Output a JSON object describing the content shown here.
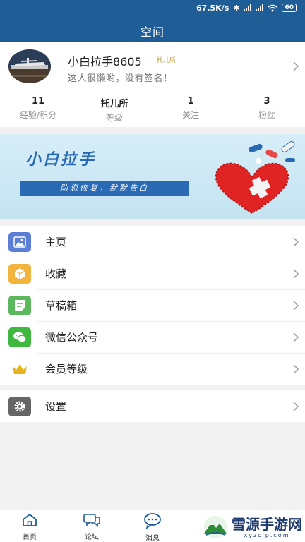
{
  "status_bar": {
    "speed": "67.5K/s",
    "battery": "60"
  },
  "header": {
    "title": "空间"
  },
  "profile": {
    "username": "小白拉手8605",
    "level_tag": "托儿所",
    "signature": "这人很懒哟，没有签名！",
    "stats": [
      {
        "value": "11",
        "label": "经验/积分"
      },
      {
        "value": "托儿所",
        "label": "等级"
      },
      {
        "value": "1",
        "label": "关注"
      },
      {
        "value": "3",
        "label": "粉丝"
      }
    ]
  },
  "banner": {
    "title": "小白拉手",
    "slogan": "助您恢复，默默告白"
  },
  "menu": [
    {
      "label": "主页",
      "icon": "image-icon",
      "color": "#5b7fd6"
    },
    {
      "label": "收藏",
      "icon": "box-icon",
      "color": "#f2b43a"
    },
    {
      "label": "草稿箱",
      "icon": "draft-icon",
      "color": "#5cb85c"
    },
    {
      "label": "微信公众号",
      "icon": "wechat-icon",
      "color": "#3fb83f"
    },
    {
      "label": "会员等级",
      "icon": "crown-icon",
      "color": "#e6b422"
    }
  ],
  "settings": {
    "label": "设置",
    "icon": "gear-icon",
    "color": "#666666"
  },
  "tabs": [
    {
      "label": "首页",
      "icon": "home-icon"
    },
    {
      "label": "论坛",
      "icon": "forum-icon"
    },
    {
      "label": "消息",
      "icon": "message-icon"
    }
  ],
  "watermark": {
    "text": "雪源手游网",
    "sub": "xyzclp.com"
  },
  "colors": {
    "primary": "#1e5d96",
    "background": "#f2f2f2"
  }
}
